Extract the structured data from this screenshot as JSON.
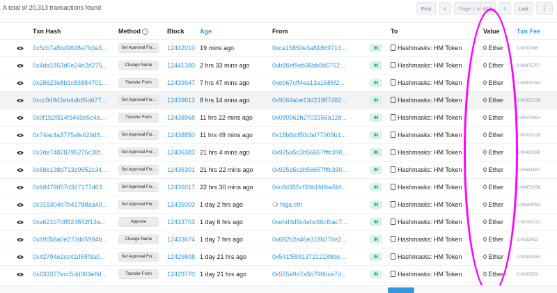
{
  "summary": "A total of 20,313 transactions found",
  "pagination": {
    "first": "First",
    "prev_icon": "chevron-left",
    "page_text": "Page 1 of 407",
    "next_icon": "chevron-right",
    "last": "Last",
    "more_icon": "ellipsis-vertical"
  },
  "columns": {
    "txn_hash": "Txn Hash",
    "method": "Method",
    "block": "Block",
    "age": "Age",
    "from": "From",
    "to": "To",
    "value": "Value",
    "txn_fee": "Txn Fee"
  },
  "direction_badge": "IN",
  "to_contract": "Hashmasks: HM Token",
  "rows": [
    {
      "hash": "0x5cb7a8bd9848a7b0a3...",
      "method": "Set Approval For...",
      "block": "12442010",
      "age": "19 mins ago",
      "from": "0xca15850e3a81869714...",
      "value": "0 Ether",
      "fee": "0.0032396"
    },
    {
      "hash": "0x4da1853d6e24e2d275...",
      "method": "Change Name",
      "block": "12441380",
      "age": "2 hrs 33 mins ago",
      "from": "0xb86ef9eb36bb8d6752...",
      "value": "0 Ether",
      "fee": "0.00875707"
    },
    {
      "hash": "0x28623e8b1c83884701...",
      "method": "Transfer From",
      "block": "12439947",
      "age": "7 hrs 47 mins ago",
      "from": "0xeb67cff4ea13a1685f2...",
      "value": "0 Ether",
      "fee": "0.00531054"
    },
    {
      "hash": "0xcc9d9d2eb4db65dd77...",
      "method": "Set Approval For...",
      "block": "12439813",
      "age": "8 hrs 14 mins ago",
      "from": "0x9064abe13d219ff7482...",
      "value": "0 Ether",
      "fee": "0.00351728"
    },
    {
      "hash": "0x9f1b2f314f3465b5c4a...",
      "method": "Transfer From",
      "block": "12438968",
      "age": "11 hrs 22 mins ago",
      "from": "0x080962b2702356a12d...",
      "value": "0 Ether",
      "fee": "0.00572954"
    },
    {
      "hash": "0x74ac4a3775afe629d8...",
      "method": "Set Approval For...",
      "block": "12438850",
      "age": "11 hrs 49 mins ago",
      "from": "0x15bfbcf50cbd77909b1...",
      "value": "0 Ether",
      "fee": "0.00333129"
    },
    {
      "hash": "0x3de74828795275c38f...",
      "method": "Set Approval For...",
      "block": "12436383",
      "age": "21 hrs 4 mins ago",
      "from": "0x925a5c3b56657fffc390...",
      "value": "0 Ether",
      "fee": "0.00467659"
    },
    {
      "hash": "0x68e138d713d9952c34...",
      "method": "Set Approval For...",
      "block": "12436301",
      "age": "21 hrs 22 mins ago",
      "from": "0x925a5c3b56657fffc390...",
      "value": "0 Ether",
      "fee": "0.00541557"
    },
    {
      "hash": "0xfdf478057d327177d63...",
      "method": "Set Approval For...",
      "block": "12436017",
      "age": "22 hrs 30 mins ago",
      "from": "0xc0d355cf39b1fdfba5bf...",
      "value": "0 Ether",
      "fee": "0.00472056"
    },
    {
      "hash": "0x315304b7b41788aa49...",
      "method": "Set Approval For...",
      "block": "12435003",
      "age": "1 day 2 hrs ago",
      "from": "higa.eth",
      "from_is_ens": true,
      "value": "0 Ether",
      "fee": "0.00584053"
    },
    {
      "hash": "0xa621b7dff824842f13a...",
      "method": "Approve",
      "block": "12433703",
      "age": "1 day 6 hrs ago",
      "from": "0xebd4d9c4ebc66cfbac7...",
      "value": "0 Ether",
      "fee": "0.00781231"
    },
    {
      "hash": "0xb9058a0e273dd5994b...",
      "method": "Change Name",
      "block": "12433674",
      "age": "1 day 7 hrs ago",
      "from": "0x682b2a46e318b27de2...",
      "value": "0 Ether",
      "fee": "0.0161452"
    },
    {
      "hash": "0x42794e2cc41d59f3a0...",
      "method": "Set Approval For...",
      "block": "12429808",
      "age": "1 day 21 hrs ago",
      "from": "0x541f599137212189be...",
      "value": "0 Ether",
      "fee": "0.00919063"
    },
    {
      "hash": "0x633377ecc5dd304e8d...",
      "method": "Transfer From",
      "block": "12429770",
      "age": "1 day 21 hrs ago",
      "from": "0x555a9d7a5b796bce7d...",
      "value": "0 Ether",
      "fee": "0.0108552"
    }
  ],
  "colors": {
    "link": "#3498db",
    "highlight": "#ff00ff",
    "in_badge_bg": "#d9f3ea",
    "in_badge_text": "#00a186"
  }
}
